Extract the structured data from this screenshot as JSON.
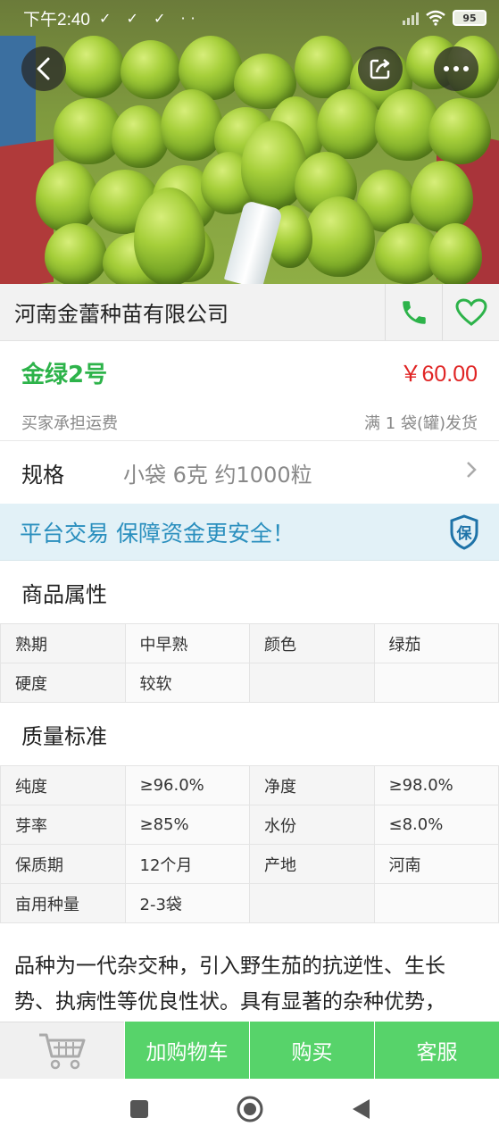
{
  "status_bar": {
    "time": "下午2:40",
    "notif_icons": "✓ ✓ ✓ ··",
    "battery": "95"
  },
  "hero": {
    "icons": [
      "back-arrow-icon",
      "share-icon",
      "more-icon"
    ]
  },
  "company": {
    "name": "河南金蕾种苗有限公司",
    "icons": [
      "phone-icon",
      "heart-icon"
    ]
  },
  "product": {
    "name": "金绿2号",
    "price": "￥60.00",
    "shipping_note": "买家承担运费",
    "min_order": "满 1 袋(罐)发货",
    "spec_label": "规格",
    "spec_value": "小袋 6克 约1000粒"
  },
  "guarantee": {
    "text": "平台交易 保障资金更安全！",
    "badge_icon": "shield-bao-icon",
    "badge_char": "保"
  },
  "attributes": {
    "title": "商品属性",
    "rows": [
      [
        "熟期",
        "中早熟",
        "颜色",
        "绿茄"
      ],
      [
        "硬度",
        "较软",
        "",
        ""
      ]
    ]
  },
  "quality": {
    "title": "质量标准",
    "rows": [
      [
        "纯度",
        "≥96.0%",
        "净度",
        "≥98.0%"
      ],
      [
        "芽率",
        "≥85%",
        "水份",
        "≤8.0%"
      ],
      [
        "保质期",
        "12个月",
        "产地",
        "河南"
      ],
      [
        "亩用种量",
        "2-3袋",
        "",
        ""
      ]
    ]
  },
  "description": "品种为一代杂交种，引入野生茄的抗逆性、生长势、执病性等优良性状。具有显著的杂种优势，",
  "bottom_bar": {
    "cart_icon": "cart-icon",
    "add_cart": "加购物车",
    "buy": "购买",
    "service": "客服"
  },
  "colors": {
    "accent_green": "#2db34a",
    "price_red": "#e02424",
    "button_green": "#57d36a",
    "guarantee_blue": "#2a8fbe"
  }
}
